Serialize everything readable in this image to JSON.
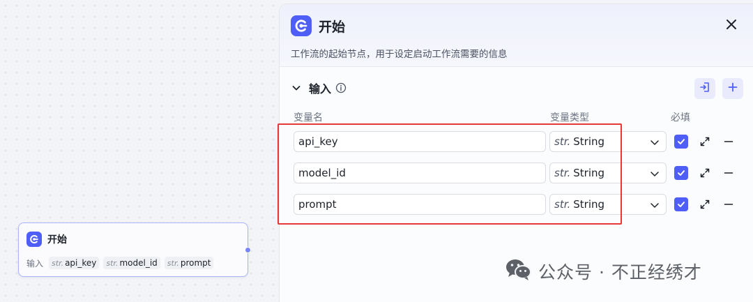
{
  "node": {
    "title": "开始",
    "input_label": "输入",
    "variables": [
      {
        "type": "str.",
        "name": "api_key"
      },
      {
        "type": "str.",
        "name": "model_id"
      },
      {
        "type": "str.",
        "name": "prompt"
      }
    ]
  },
  "panel": {
    "title": "开始",
    "description": "工作流的起始节点，用于设定启动工作流需要的信息",
    "section": {
      "title": "输入"
    },
    "columns": {
      "name": "变量名",
      "type": "变量类型",
      "required": "必填"
    },
    "rows": [
      {
        "name": "api_key",
        "type_prefix": "str.",
        "type": "String",
        "required": true
      },
      {
        "name": "model_id",
        "type_prefix": "str.",
        "type": "String",
        "required": true
      },
      {
        "name": "prompt",
        "type_prefix": "str.",
        "type": "String",
        "required": true
      }
    ]
  },
  "watermark": {
    "text": "公众号 · 不正经绣才"
  },
  "colors": {
    "accent": "#4e5ef7",
    "highlight": "#e53935",
    "node_border": "#a9b4f7"
  },
  "icons": [
    "coze-logo-icon",
    "close-icon",
    "chevron-down-icon",
    "info-icon",
    "import-icon",
    "plus-icon",
    "caret-down-icon",
    "checkbox-checked-icon",
    "expand-icon",
    "minus-icon",
    "wechat-icon"
  ]
}
